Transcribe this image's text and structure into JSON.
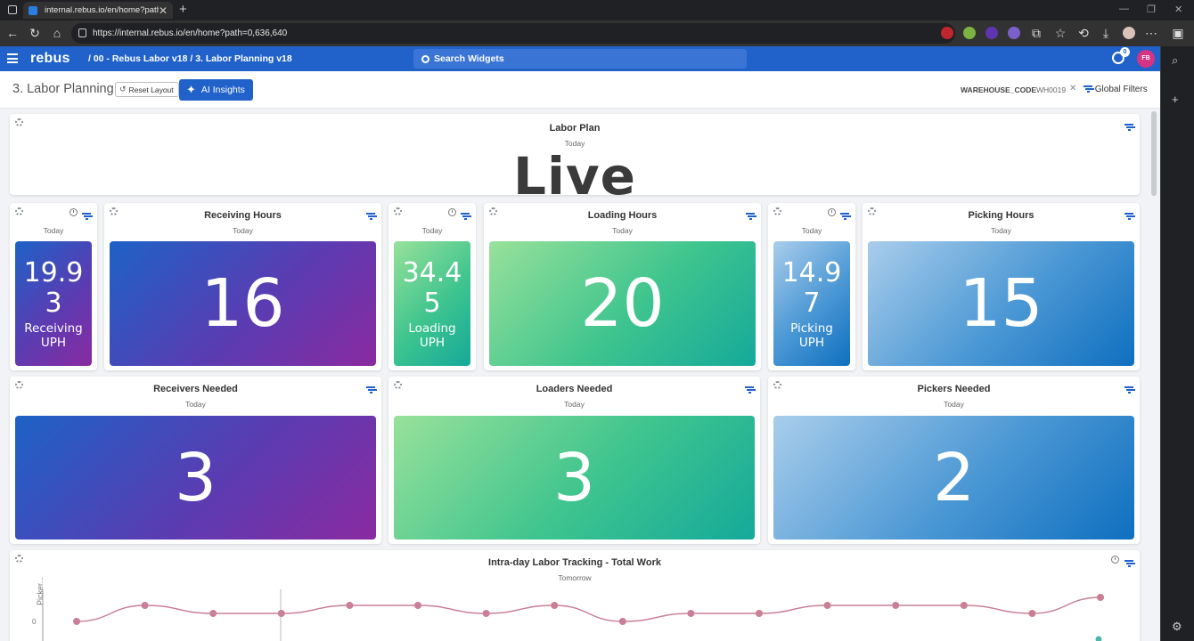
{
  "browser": {
    "tab_title": "internal.rebus.io/en/home?path=",
    "url": "https://internal.rebus.io/en/home?path=0,636,640"
  },
  "app": {
    "logo": "rebus",
    "breadcrumb": "/ 00 - Rebus Labor v18  /  3. Labor Planning v18",
    "search_placeholder": "Search Widgets",
    "notification_count": "0",
    "user_initials": "FB"
  },
  "toolbar": {
    "page_title": "3. Labor Planning",
    "reset_label": "Reset Layout",
    "ai_label": "AI Insights",
    "filter_key": "WAREHOUSE_CODE",
    "filter_value": "WH0019",
    "global_filters_label": "Global Filters"
  },
  "labor_plan": {
    "title": "Labor Plan",
    "subtitle": "Today",
    "value": "Live"
  },
  "row1": {
    "receiving_uph": {
      "subtitle": "Today",
      "num_line1": "19.9",
      "num_line2": "3",
      "label_line1": "Receiving",
      "label_line2": "UPH"
    },
    "receiving_hours": {
      "title": "Receiving Hours",
      "subtitle": "Today",
      "value": "16"
    },
    "loading_uph": {
      "subtitle": "Today",
      "num_line1": "34.4",
      "num_line2": "5",
      "label_line1": "Loading",
      "label_line2": "UPH"
    },
    "loading_hours": {
      "title": "Loading Hours",
      "subtitle": "Today",
      "value": "20"
    },
    "picking_uph": {
      "subtitle": "Today",
      "num_line1": "14.9",
      "num_line2": "7",
      "label_line1": "Picking",
      "label_line2": "UPH"
    },
    "picking_hours": {
      "title": "Picking Hours",
      "subtitle": "Today",
      "value": "15"
    }
  },
  "row2": {
    "receivers": {
      "title": "Receivers Needed",
      "subtitle": "Today",
      "value": "3"
    },
    "loaders": {
      "title": "Loaders Needed",
      "subtitle": "Today",
      "value": "3"
    },
    "pickers": {
      "title": "Pickers Needed",
      "subtitle": "Today",
      "value": "2"
    }
  },
  "tracking": {
    "title": "Intra-day Labor Tracking - Total Work",
    "subtitle": "Tomorrow",
    "y_axis_label": "Picker...",
    "y_tick": "0",
    "line_color": "#c97f95",
    "values": [
      0.0,
      0.9,
      0.45,
      0.45,
      0.9,
      0.9,
      0.45,
      0.9,
      0.0,
      0.45,
      0.45,
      0.9,
      0.9,
      0.9,
      0.45,
      1.35
    ]
  },
  "colors": {
    "brand": "#2062ca",
    "purple_gradient": [
      "#1d62c6",
      "#8a2aa0"
    ],
    "green_gradient": [
      "#98e19a",
      "#15a99a"
    ],
    "blue_gradient": [
      "#a9cdeb",
      "#0f6fbf"
    ]
  }
}
